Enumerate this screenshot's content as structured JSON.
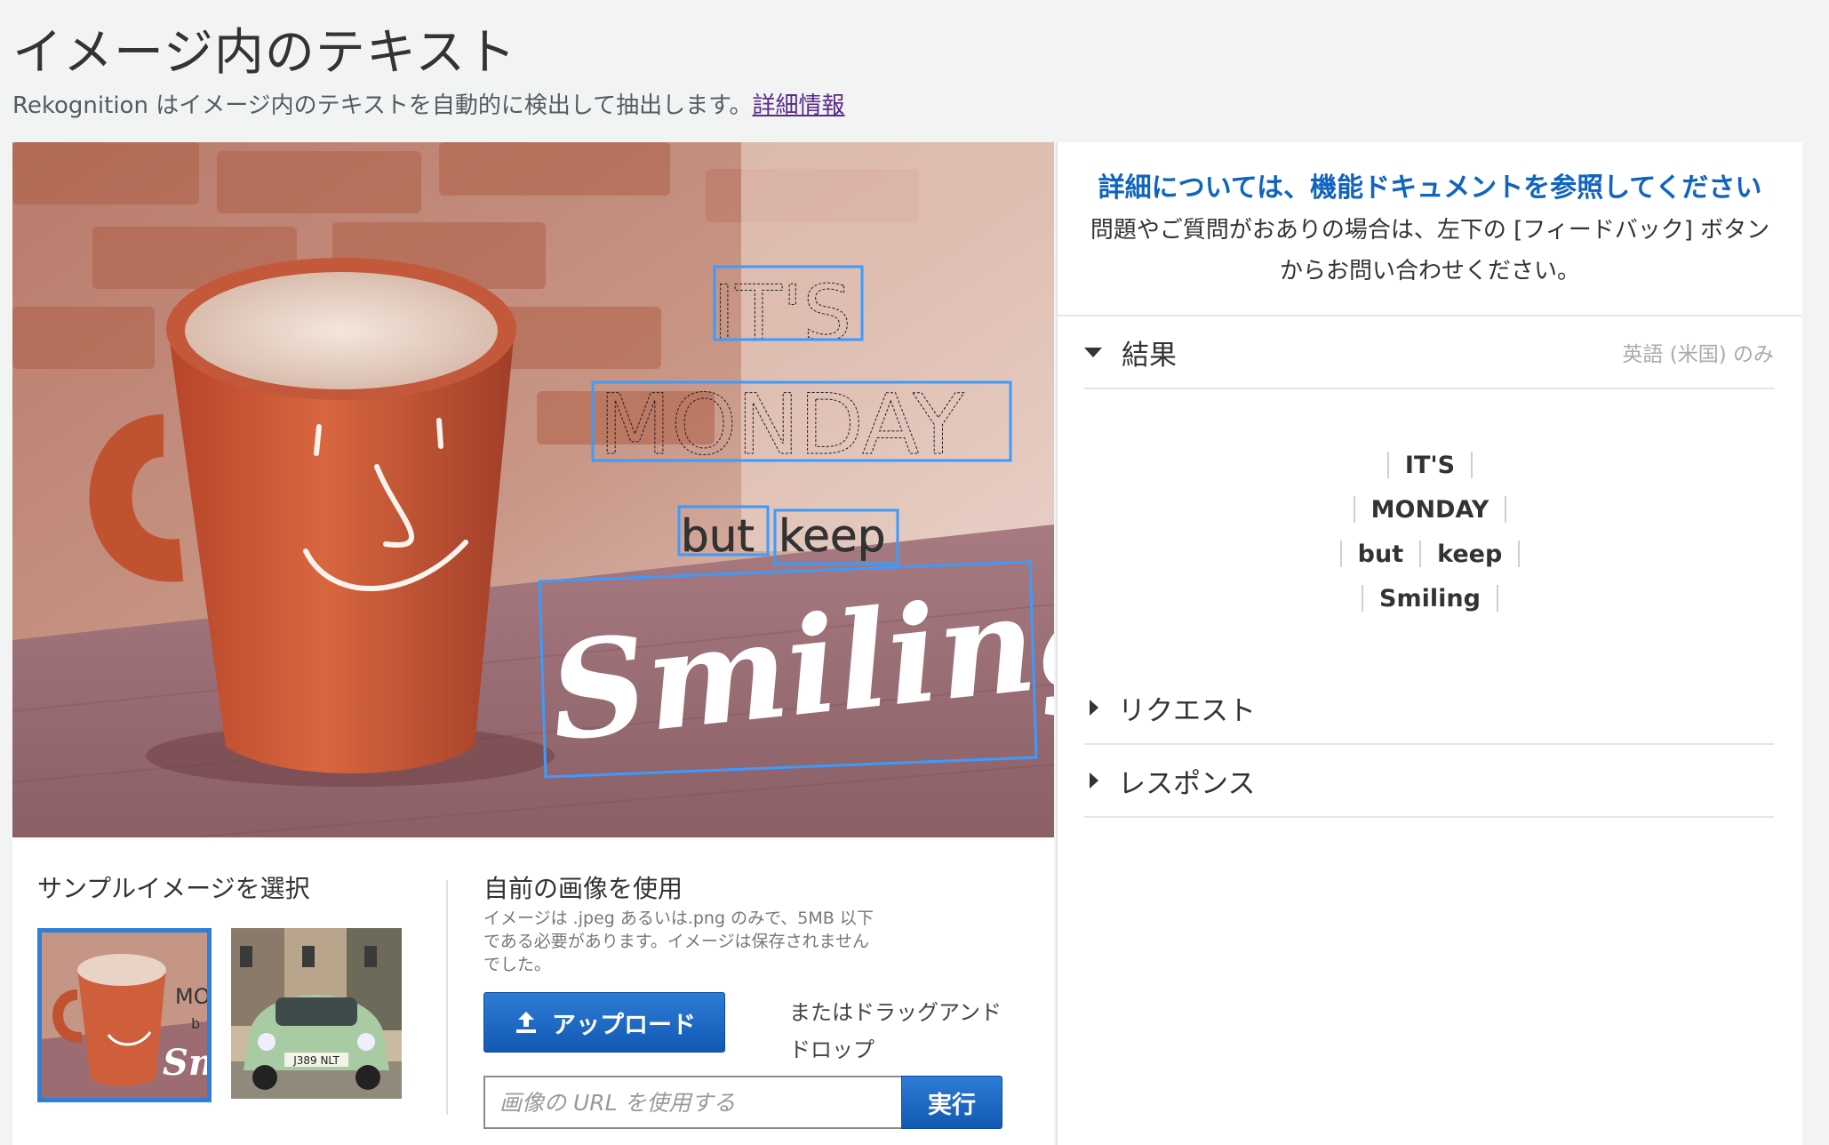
{
  "header": {
    "title": "イメージ内のテキスト",
    "subtitle": "Rekognition はイメージ内のテキストを自動的に検出して抽出します。",
    "learn_more": "詳細情報"
  },
  "image": {
    "detected_words": [
      "IT'S",
      "MONDAY",
      "but",
      "keep",
      "Smiling"
    ],
    "box_color": "#3b9bff"
  },
  "samples": {
    "title": "サンプルイメージを選択",
    "items": [
      "coffee-mug",
      "green-car"
    ],
    "car_plate": "J389 NLT",
    "mug_thumb_text": [
      "MO",
      "b",
      "Sm"
    ]
  },
  "upload": {
    "title": "自前の画像を使用",
    "description": "イメージは .jpeg あるいは.png のみで、5MB 以下である必要があります。イメージは保存されませんでした。",
    "button_label": "アップロード",
    "drag_text": "またはドラッグアンド ドロップ",
    "url_placeholder": "画像の URL を使用する",
    "run_label": "実行"
  },
  "right_panel": {
    "doc_link": "詳細については、機能ドキュメントを参照してください",
    "help_line1": "問題やご質問がおありの場合は、左下の [フィードバック] ボタン",
    "help_line2": "からお問い合わせください。",
    "results_label": "結果",
    "results_note": "英語 (米国) のみ",
    "results_rows": [
      [
        "IT'S"
      ],
      [
        "MONDAY"
      ],
      [
        "but",
        "keep"
      ],
      [
        "Smiling"
      ]
    ],
    "request_label": "リクエスト",
    "response_label": "レスポンス"
  },
  "colors": {
    "accent": "#1f6fc8",
    "link": "#0f64c0",
    "visited_link": "#5a2a8a"
  }
}
